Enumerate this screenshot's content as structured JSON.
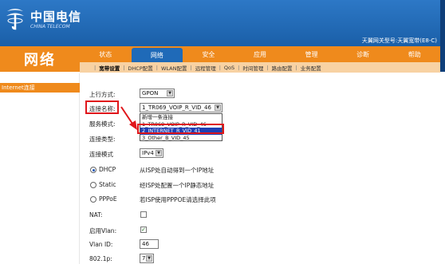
{
  "header": {
    "brand": "中国电信",
    "brand_sub": "CHINA TELECOM",
    "model_info": "天翼网关型号:天翼宽带(E8-C)"
  },
  "section_title": "网络",
  "topnav": [
    "状态",
    "网络",
    "安全",
    "应用",
    "管理",
    "诊断",
    "帮助"
  ],
  "topnav_active": 1,
  "subnav": [
    "宽带设置",
    "DHCP配置",
    "WLAN配置",
    "远程管理",
    "QoS",
    "时间管理",
    "路由配置",
    "业务配置"
  ],
  "subnav_active": 0,
  "sidebar": {
    "item": "Internet连接"
  },
  "form": {
    "uplink_label": "上行方式:",
    "uplink_value": "GPON",
    "conn_name_label": "连接名称:",
    "conn_name_value": "1_TR069_VOIP_R_VID_46",
    "service_label": "服务模式:",
    "conn_type_label": "连接类型:",
    "conn_mode_label": "连接模式",
    "conn_mode_value": "IPv4",
    "dhcp_label": "DHCP",
    "dhcp_desc": "从ISP处自动得到一个IP地址",
    "static_label": "Static",
    "static_desc": "经ISP处配置一个IP静态地址",
    "pppoe_label": "PPPoE",
    "pppoe_desc": "若ISP使用PPPOE请选择此项",
    "nat_label": "NAT:",
    "enable_vlan_label": "启用Vlan:",
    "enable_vlan_mark": "✓",
    "vlan_id_label": "Vlan ID:",
    "vlan_id_value": "46",
    "p8021_label": "802.1p:",
    "p8021_value": "7"
  },
  "dropdown_options": [
    "新增一条连接",
    "1_TR069_VOIP_R_VID_46",
    "2_INTERNET_R_VID_41",
    "3_Other_B_VID_45"
  ],
  "dropdown_selected": 2,
  "colors": {
    "header_blue": "#1a5fa8",
    "nav_orange": "#ef8a1c",
    "highlight_red": "#e0161b",
    "selection_blue": "#1f3fb4"
  }
}
